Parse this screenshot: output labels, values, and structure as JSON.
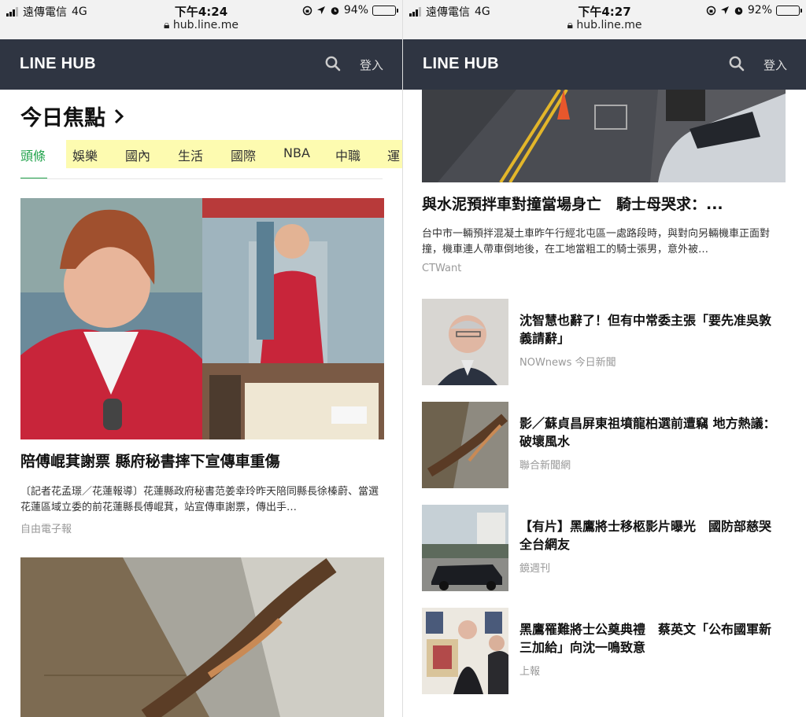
{
  "left": {
    "status": {
      "carrier": "遠傳電信",
      "network": "4G",
      "time": "下午4:24",
      "battery": "94%",
      "battery_level": 0.94
    },
    "url": "hub.line.me",
    "header": {
      "logo": "LINE HUB",
      "login": "登入"
    },
    "section_title": "今日焦點",
    "tabs": [
      {
        "label": "頭條",
        "active": true
      },
      {
        "label": "娛樂"
      },
      {
        "label": "國內"
      },
      {
        "label": "生活"
      },
      {
        "label": "國際"
      },
      {
        "label": "NBA"
      },
      {
        "label": "中職"
      },
      {
        "label": "運"
      }
    ],
    "featured": {
      "title": "陪傅崐萁謝票 縣府秘書摔下宣傳車重傷",
      "summary": "〔記者花孟璟／花蓮報導〕花蓮縣政府秘書范姜幸玲昨天陪同縣長徐榛蔚、當選花蓮區域立委的前花蓮縣長傅崐萁，站宣傳車謝票，傳出手…",
      "source": "自由電子報"
    }
  },
  "right": {
    "status": {
      "carrier": "遠傳電信",
      "network": "4G",
      "time": "下午4:27",
      "battery": "92%",
      "battery_level": 0.92
    },
    "url": "hub.line.me",
    "header": {
      "logo": "LINE HUB",
      "login": "登入"
    },
    "top_article": {
      "title": "與水泥預拌車對撞當場身亡　騎士母哭求：...",
      "summary": "台中市一輛預拌混凝土車昨午行經北屯區一處路段時，與對向另輛機車正面對撞，機車連人帶車倒地後，在工地當粗工的騎士張男，意外被…",
      "source": "CTWant"
    },
    "items": [
      {
        "title": "沈智慧也辭了！但有中常委主張「要先准吳敦義請辭」",
        "source": "NOWnews 今日新聞"
      },
      {
        "title": "影／蘇貞昌屏東祖墳龍柏選前遭竊 地方熱議：破壞風水",
        "source": "聯合新聞網"
      },
      {
        "title": "【有片】黑鷹將士移柩影片曝光　國防部慈哭全台網友",
        "source": "鏡週刊"
      },
      {
        "title": "黑鷹罹難將士公奠典禮　蔡英文「公布國軍新三加給」向沈一鳴致意",
        "source": "上報"
      }
    ]
  },
  "colors": {
    "header_bg": "#2f3542",
    "accent_green": "#1fa24a",
    "tab_highlight": "#fdfbb0"
  }
}
